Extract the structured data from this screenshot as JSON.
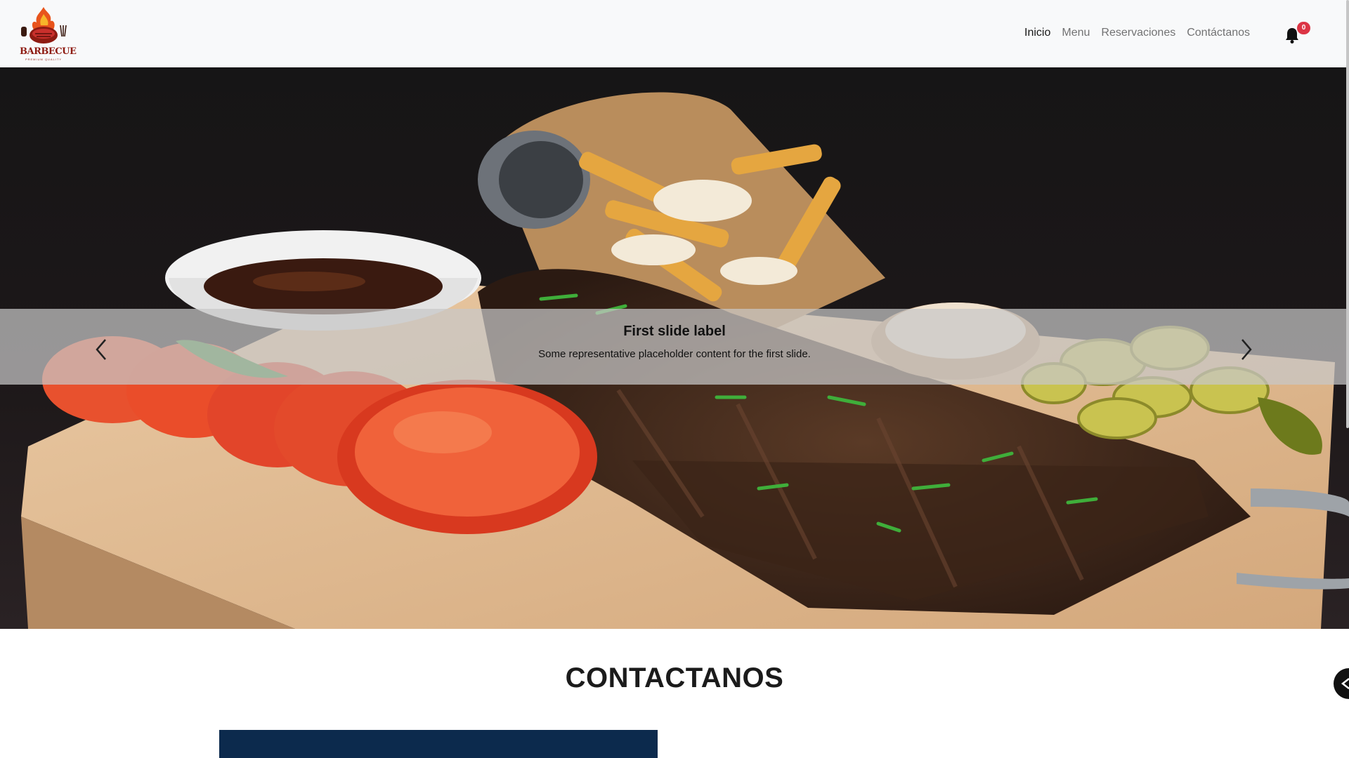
{
  "brand": {
    "logo_text": "BARBECUE",
    "logo_subtext": "PREMIUM QUALITY"
  },
  "nav": {
    "items": [
      {
        "label": "Inicio",
        "active": true
      },
      {
        "label": "Menu",
        "active": false
      },
      {
        "label": "Reservaciones",
        "active": false
      },
      {
        "label": "Contáctanos",
        "active": false
      }
    ],
    "notification_count": "0"
  },
  "carousel": {
    "slide_title": "First slide label",
    "slide_text": "Some representative placeholder content for the first slide."
  },
  "contact": {
    "title": "CONTACTANOS"
  },
  "colors": {
    "navbar_bg": "#f8f9fa",
    "badge": "#dc3545",
    "contact_panel": "#0c2a4d",
    "logo_accent": "#8e1b12"
  },
  "icons": {
    "bell": "bell-icon",
    "prev": "chevron-left-icon",
    "next": "chevron-right-icon",
    "scroll_top": "chevron-up-icon"
  }
}
